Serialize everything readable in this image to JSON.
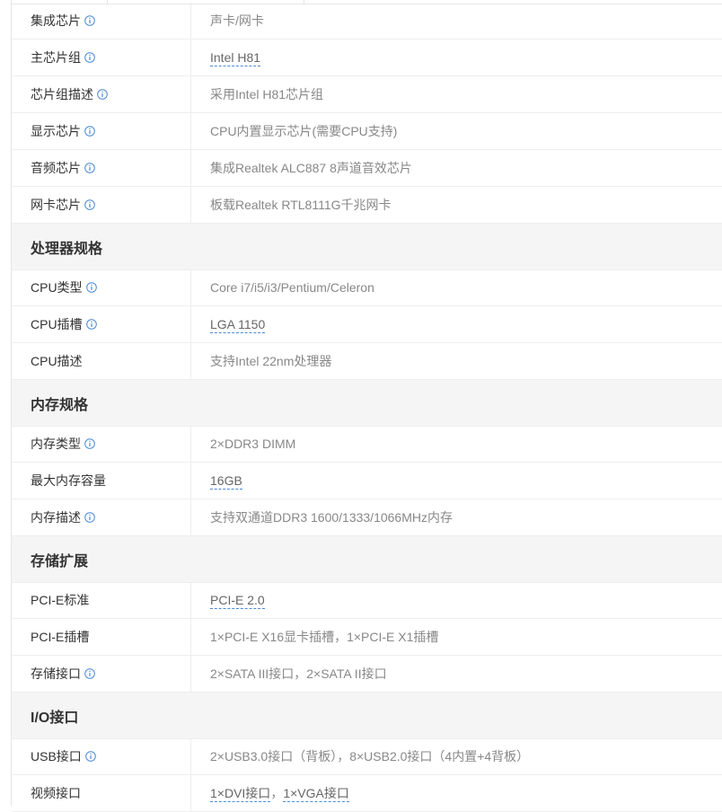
{
  "rows_top": [
    {
      "key": "集成芯片",
      "value": "声卡/网卡",
      "info": true,
      "link": false
    },
    {
      "key": "主芯片组",
      "value": "Intel H81",
      "info": true,
      "link": true
    },
    {
      "key": "芯片组描述",
      "value": "采用Intel H81芯片组",
      "info": true,
      "link": false
    },
    {
      "key": "显示芯片",
      "value": "CPU内置显示芯片(需要CPU支持)",
      "info": true,
      "link": false
    },
    {
      "key": "音频芯片",
      "value": "集成Realtek ALC887 8声道音效芯片",
      "info": true,
      "link": false
    },
    {
      "key": "网卡芯片",
      "value": "板载Realtek RTL8111G千兆网卡",
      "info": true,
      "link": false
    }
  ],
  "sections": {
    "cpu": {
      "title": "处理器规格",
      "rows": [
        {
          "key": "CPU类型",
          "value": "Core i7/i5/i3/Pentium/Celeron",
          "info": true,
          "link": false
        },
        {
          "key": "CPU插槽",
          "value": "LGA 1150",
          "info": true,
          "link": true
        },
        {
          "key": "CPU描述",
          "value": "支持Intel 22nm处理器",
          "info": false,
          "link": false
        }
      ]
    },
    "memory": {
      "title": "内存规格",
      "rows": [
        {
          "key": "内存类型",
          "value": "2×DDR3 DIMM",
          "info": true,
          "link": false
        },
        {
          "key": "最大内存容量",
          "value": "16GB",
          "info": false,
          "link": true
        },
        {
          "key": "内存描述",
          "value": "支持双通道DDR3 1600/1333/1066MHz内存",
          "info": true,
          "link": false
        }
      ]
    },
    "storage": {
      "title": "存储扩展",
      "rows": [
        {
          "key": "PCI-E标准",
          "value": "PCI-E 2.0",
          "info": false,
          "link": true
        },
        {
          "key": "PCI-E插槽",
          "value": "1×PCI-E X16显卡插槽，1×PCI-E X1插槽",
          "info": false,
          "link": false
        },
        {
          "key": "存储接口",
          "value": "2×SATA III接口，2×SATA II接口",
          "info": true,
          "link": false
        }
      ]
    },
    "io": {
      "title": "I/O接口",
      "rows": [
        {
          "key": "USB接口",
          "value": "2×USB3.0接口（背板），8×USB2.0接口（4内置+4背板）",
          "info": true,
          "link": false
        },
        {
          "key": "视频接口",
          "value_links": [
            "1×DVI接口",
            "1×VGA接口"
          ],
          "separator": "，",
          "info": false
        }
      ]
    }
  },
  "colors": {
    "info_icon": "#4a8ad6",
    "link_underline": "#4a8ad6",
    "section_bg": "#f5f5f5"
  },
  "icon_names": {
    "info": "info-circle-icon"
  }
}
